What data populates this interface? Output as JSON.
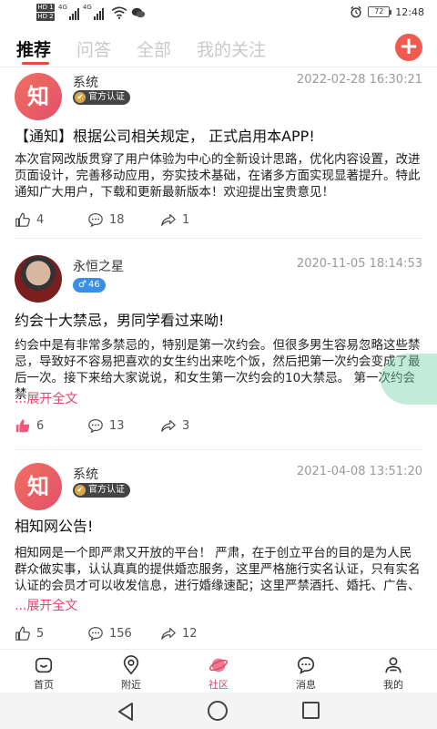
{
  "status_bar": {
    "hd1": "HD 1",
    "hd2": "HD 2",
    "net1": "4G",
    "net2": "4G",
    "battery": "72",
    "time": "12:48"
  },
  "tabs": [
    {
      "label": "推荐",
      "active": true
    },
    {
      "label": "问答",
      "active": false
    },
    {
      "label": "全部",
      "active": false
    },
    {
      "label": "我的关注",
      "active": false
    }
  ],
  "add_button": "+",
  "posts": [
    {
      "avatar_text": "知",
      "author": "系统",
      "badge": "官方认证",
      "time": "2022-02-28 16:30:21",
      "title": "【通知】根据公司相关规定， 正式启用本APP!",
      "body": "本次官网改版贯穿了用户体验为中心的全新设计思路，优化内容设置，改进页面设计，完善移动应用，夯实技术基础，在诸多方面实现显著提升。特此通知广大用户，下载和更新最新版本！欢迎提出宝贵意见！",
      "likes": "4",
      "comments": "18",
      "shares": "1"
    },
    {
      "avatar_text": "",
      "author": "永恒之星",
      "badge": "46",
      "time": "2020-11-05 18:14:53",
      "title": "约会十大禁忌，男同学看过来呦!",
      "body": "约会中是有非常多禁忌的，特别是第一次约会。但很多男生容易忽略这些禁忌，导致好不容易把喜欢的女生约出来吃个饭，然后把第一次约会变成了最后一次。接下来给大家说说，和女生第一次约会的10大禁忌。 第一次约会禁",
      "expand": "...展开全文",
      "likes": "6",
      "comments": "13",
      "shares": "3"
    },
    {
      "avatar_text": "知",
      "author": "系统",
      "badge": "官方认证",
      "time": "2021-04-08 13:51:20",
      "title": "相知网公告!",
      "body": "相知网是一个即严肃又开放的平台！ 严肃，在于创立平台的目的是为人民群众做实事，认认真真的提供婚恋服务，这里严格施行实名认证，只有实名认证的会员才可以收发信息，进行婚缘速配；这里严禁酒托、婚托、广告、",
      "expand": "...展开全文",
      "likes": "5",
      "comments": "156",
      "shares": "12"
    }
  ],
  "bottom_nav": [
    {
      "label": "首页"
    },
    {
      "label": "附近"
    },
    {
      "label": "社区"
    },
    {
      "label": "消息"
    },
    {
      "label": "我的"
    }
  ],
  "colors": {
    "accent": "#e8436a",
    "tab_underline": "#e84a3f",
    "official_badge": "#444444",
    "level_badge": "#3a8ee6"
  },
  "icons": {
    "like": "thumbs-up-icon",
    "comment": "comment-icon",
    "share": "share-icon"
  }
}
